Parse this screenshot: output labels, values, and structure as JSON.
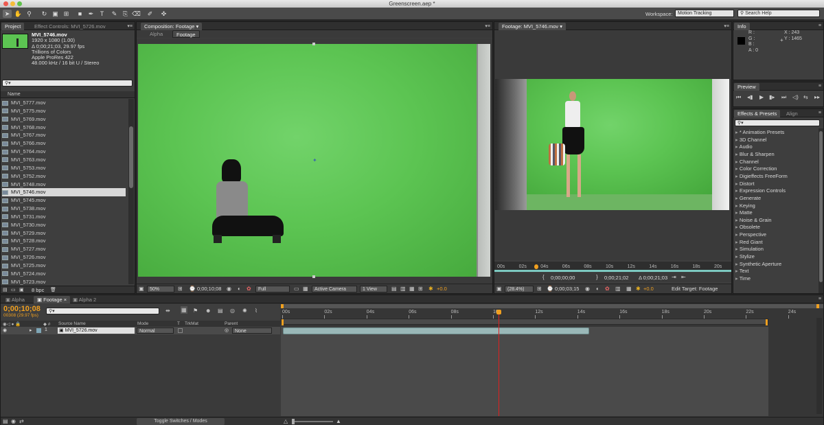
{
  "window": {
    "title": "Greenscreen.aep *"
  },
  "workspace": {
    "label": "Workspace:",
    "value": "Motion Tracking",
    "search_placeholder": "Search Help"
  },
  "project": {
    "tabs": [
      "Project",
      "Effect Controls: MVI_5726.mov"
    ],
    "file": {
      "name": "MVI_5746.mov",
      "res": "1920 x 1080 (1.00)",
      "duration": "Δ 0;00;21;03, 29.97 fps",
      "colors": "Trillions of Colors",
      "codec": "Apple ProRes 422",
      "audio": "48.000 kHz / 16 bit U / Stereo"
    },
    "column": "Name",
    "items": [
      "MVI_5777.mov",
      "MVI_5775.mov",
      "MVI_5769.mov",
      "MVI_5768.mov",
      "MVI_5767.mov",
      "MVI_5766.mov",
      "MVI_5764.mov",
      "MVI_5763.mov",
      "MVI_5753.mov",
      "MVI_5752.mov",
      "MVI_5748.mov",
      "MVI_5746.mov",
      "MVI_5745.mov",
      "MVI_5738.mov",
      "MVI_5731.mov",
      "MVI_5730.mov",
      "MVI_5729.mov",
      "MVI_5728.mov",
      "MVI_5727.mov",
      "MVI_5726.mov",
      "MVI_5725.mov",
      "MVI_5724.mov",
      "MVI_5723.mov"
    ],
    "selected": "MVI_5746.mov",
    "bpc": "8 bpc"
  },
  "composition": {
    "tab": "Composition: Footage",
    "subtabs": [
      "Alpha",
      "Footage"
    ],
    "zoom": "50%",
    "timecode": "0;00;10;08",
    "resolution": "Full",
    "camera": "Active Camera",
    "view": "1 View",
    "exposure": "+0.0"
  },
  "footage": {
    "tab": "Footage: MVI_5746.mov",
    "ruler": [
      "00s",
      "02s",
      "04s",
      "06s",
      "08s",
      "10s",
      "12s",
      "14s",
      "16s",
      "18s",
      "20s"
    ],
    "in": "0;00;00;00",
    "out": "0;00;21;02",
    "duration": "Δ 0;00;21;03",
    "zoom": "(28.4%)",
    "timecode": "0;00;03;15",
    "exposure": "+0.0",
    "edit_target": "Edit Target: Footage"
  },
  "info": {
    "tab": "Info",
    "labels": [
      "R :",
      "G :",
      "B :",
      "A : 0"
    ],
    "x": "X : 243",
    "y": "Y : 1465"
  },
  "preview": {
    "tab": "Preview"
  },
  "effects": {
    "tabs": [
      "Effects & Presets",
      "Align"
    ],
    "items": [
      "* Animation Presets",
      "3D Channel",
      "Audio",
      "Blur & Sharpen",
      "Channel",
      "Color Correction",
      "Digieffects FreeForm",
      "Distort",
      "Expression Controls",
      "Generate",
      "Keying",
      "Matte",
      "Noise & Grain",
      "Obsolete",
      "Perspective",
      "Red Giant",
      "Simulation",
      "Stylize",
      "Synthetic Aperture",
      "Text",
      "Time"
    ]
  },
  "timeline": {
    "tabs": [
      "Alpha",
      "Footage",
      "Alpha 2"
    ],
    "timecode": "0;00;10;08",
    "frames": "00308 (29.97 fps)",
    "columns": {
      "source": "Source Name",
      "mode": "Mode",
      "t": "T",
      "trkmat": "TrkMat",
      "parent": "Parent"
    },
    "layer": {
      "index": "1",
      "name": "MVI_5726.mov",
      "mode": "Normal",
      "parent": "None"
    },
    "ruler": [
      "00s",
      "02s",
      "04s",
      "06s",
      "08s",
      "10s",
      "12s",
      "14s",
      "16s",
      "18s",
      "20s",
      "22s",
      "24s"
    ],
    "toggle": "Toggle Switches / Modes"
  },
  "colors": {
    "accent": "#f0a020",
    "playhead": "#e02020",
    "green": "#5cc452",
    "layer_bar": "#9ab8b8"
  }
}
